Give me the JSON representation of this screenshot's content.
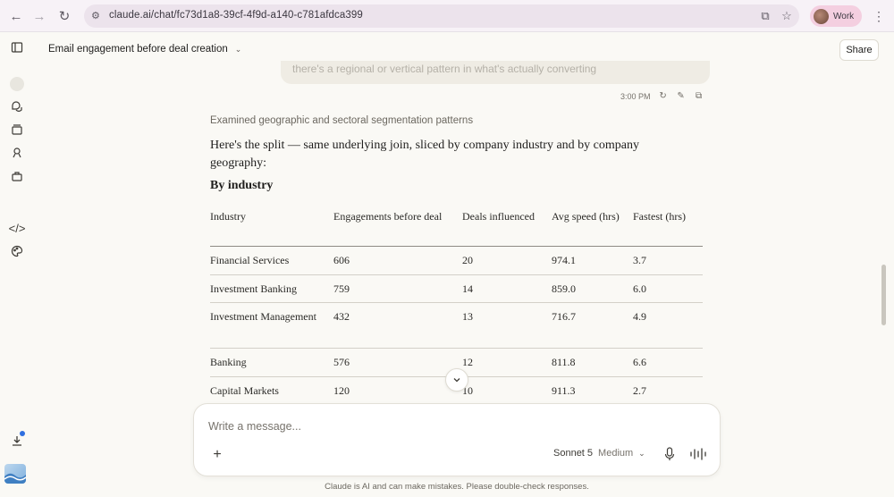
{
  "browser": {
    "url": "claude.ai/chat/fc73d1a8-39cf-4f9d-a140-c781afdca399",
    "profile_label": "Work"
  },
  "header": {
    "conversation_title": "Email engagement before deal creation",
    "share_label": "Share"
  },
  "previous_message": {
    "text_fragment": "there's a regional or vertical pattern in what's actually converting",
    "time": "3:00 PM"
  },
  "assistant": {
    "thought_summary": "Examined geographic and sectoral segmentation patterns",
    "intro": "Here's the split — same underlying join, sliced by company industry and by company geography:",
    "section_heading": "By industry",
    "table": {
      "headers": [
        "Industry",
        "Engagements before deal",
        "Deals influenced",
        "Avg speed (hrs)",
        "Fastest (hrs)"
      ],
      "rows": [
        [
          "Financial Services",
          "606",
          "20",
          "974.1",
          "3.7"
        ],
        [
          "Investment Banking",
          "759",
          "14",
          "859.0",
          "6.0"
        ],
        [
          "Investment Management",
          "432",
          "13",
          "716.7",
          "4.9"
        ],
        [
          "Banking",
          "576",
          "12",
          "811.8",
          "6.6"
        ],
        [
          "Capital Markets",
          "120",
          "10",
          "911.3",
          "2.7"
        ]
      ]
    }
  },
  "composer": {
    "placeholder": "Write a message...",
    "model": "Sonnet 5",
    "effort": "Medium"
  },
  "footer": {
    "disclaimer": "Claude is AI and can make mistakes. Please double-check responses."
  }
}
